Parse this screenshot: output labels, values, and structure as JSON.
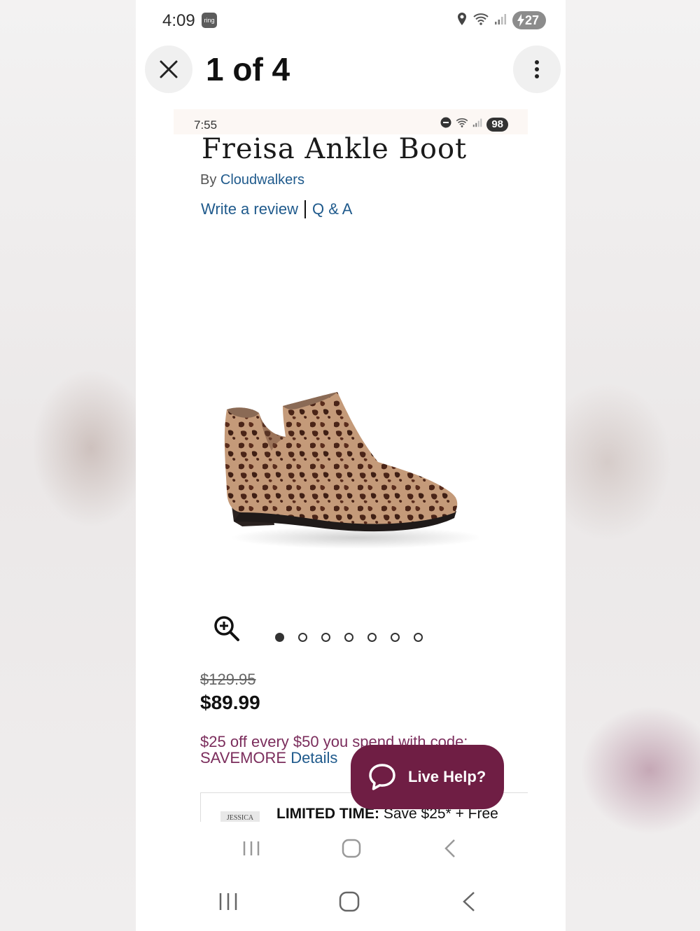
{
  "outer_status": {
    "time": "4:09",
    "ring_badge": "ring",
    "battery": "27",
    "icons": [
      "location-icon",
      "wifi-icon",
      "signal-icon",
      "battery-charging-icon"
    ]
  },
  "viewer": {
    "counter": "1 of 4",
    "close_icon": "close-icon",
    "menu_icon": "more-vertical-icon"
  },
  "inner_status": {
    "time": "7:55",
    "battery": "98",
    "icons": [
      "dnd-icon",
      "wifi-icon",
      "signal-icon",
      "battery-icon"
    ]
  },
  "product": {
    "title": "Freisa Ankle Boot",
    "by_prefix": "By",
    "brand": "Cloudwalkers",
    "write_review": "Write a review",
    "qa": "Q & A",
    "image_icon": "leopard-ankle-boot-image",
    "original_price": "$129.95",
    "sale_price": "$89.99",
    "image_count": 7,
    "active_image": 0
  },
  "promo": {
    "text": "$25 off every $50 you spend with code:",
    "code": "SAVEMORE",
    "details": "Details"
  },
  "live_help": {
    "label": "Live Help?"
  },
  "banner": {
    "logo": "JESSICA",
    "bold_text": "LIMITED TIME:",
    "text": " Save $25* + Free"
  },
  "colors": {
    "accent_maroon": "#6f1e44",
    "link_blue": "#1f5a8c",
    "promo_purple": "#7b2d5c"
  }
}
